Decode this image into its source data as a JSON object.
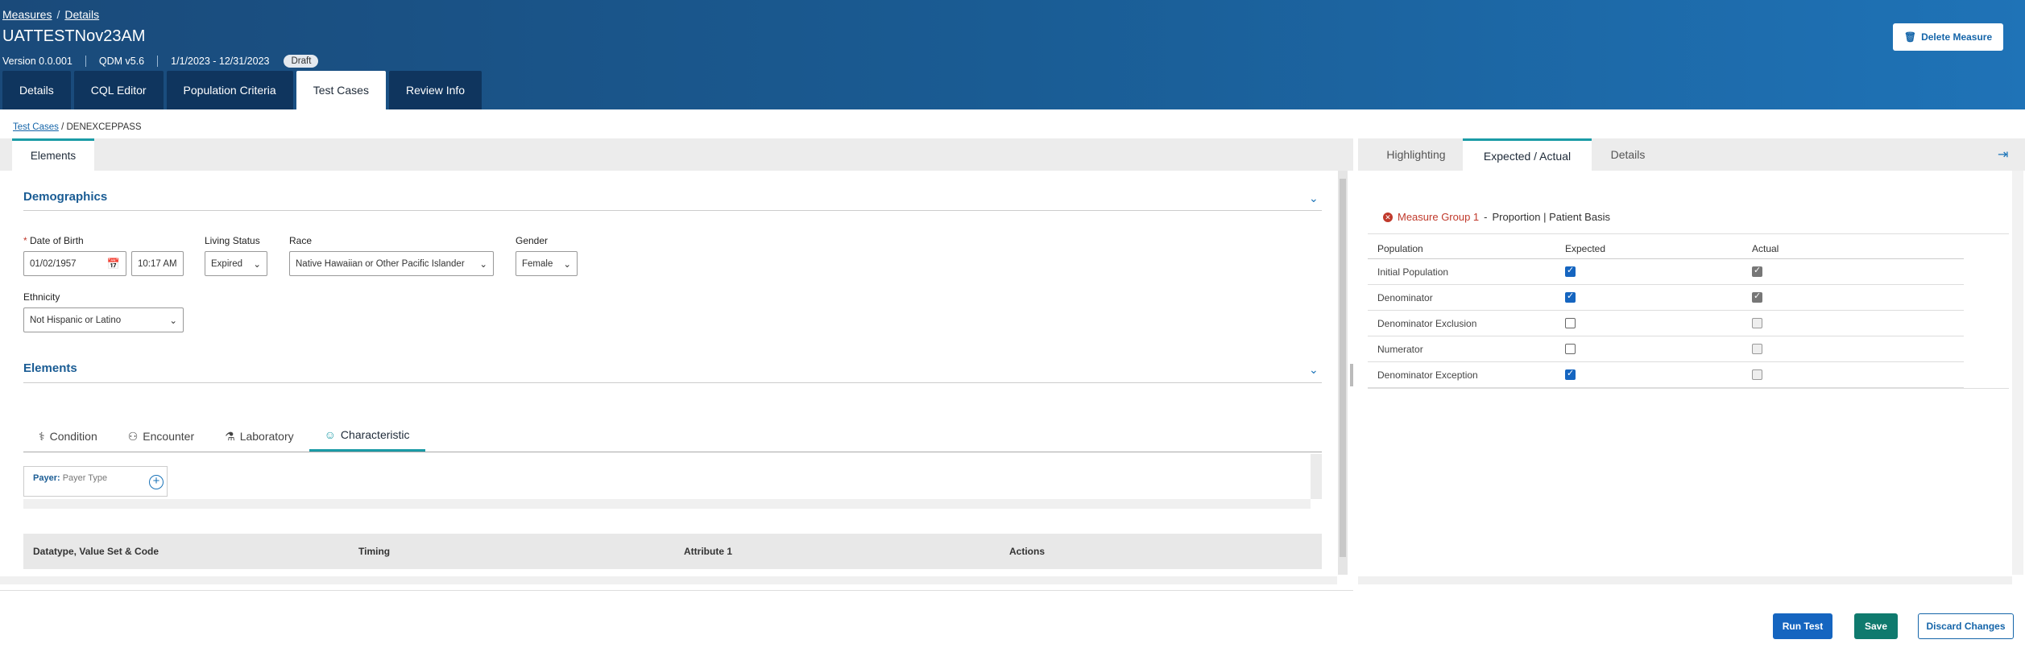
{
  "breadcrumb": {
    "measures": "Measures",
    "separator": "/",
    "details": "Details"
  },
  "measure": {
    "title": "UATTESTNov23AM",
    "version": "Version 0.0.001",
    "qdm": "QDM v5.6",
    "period": "1/1/2023 - 12/31/2023",
    "status": "Draft"
  },
  "delete_button": "Delete Measure",
  "main_tabs": [
    "Details",
    "CQL Editor",
    "Population Criteria",
    "Test Cases",
    "Review Info"
  ],
  "test_breadcrumb": {
    "link": "Test Cases",
    "current": "/ DENEXCEPPASS"
  },
  "left_tab": "Elements",
  "demographics": {
    "heading": "Demographics",
    "dob_label": "Date of Birth",
    "dob_value": "01/02/1957",
    "time_value": "10:17 AM",
    "living_label": "Living Status",
    "living_value": "Expired",
    "race_label": "Race",
    "race_value": "Native Hawaiian or Other Pacific Islander",
    "gender_label": "Gender",
    "gender_value": "Female",
    "ethnicity_label": "Ethnicity",
    "ethnicity_value": "Not Hispanic or Latino"
  },
  "elements": {
    "heading": "Elements",
    "tabs": [
      "Condition",
      "Encounter",
      "Laboratory",
      "Characteristic"
    ],
    "payer_label": "Payer:",
    "payer_type": "Payer Type",
    "columns": [
      "Datatype, Value Set & Code",
      "Timing",
      "Attribute 1",
      "Actions"
    ]
  },
  "right_tabs": [
    "Highlighting",
    "Expected / Actual",
    "Details"
  ],
  "measure_group": {
    "title": "Measure Group 1",
    "dash": " - ",
    "subtitle": "Proportion | Patient Basis"
  },
  "population_table": {
    "headers": [
      "Population",
      "Expected",
      "Actual"
    ],
    "rows": [
      {
        "name": "Initial Population",
        "expected": true,
        "actual": true
      },
      {
        "name": "Denominator",
        "expected": true,
        "actual": true
      },
      {
        "name": "Denominator Exclusion",
        "expected": false,
        "actual": false
      },
      {
        "name": "Numerator",
        "expected": false,
        "actual": false
      },
      {
        "name": "Denominator Exception",
        "expected": true,
        "actual": false
      }
    ]
  },
  "footer": {
    "run": "Run Test",
    "save": "Save",
    "discard": "Discard Changes"
  },
  "colors": {
    "header_dark": "#1a4a7a",
    "tab_dark": "#0f355e",
    "accent_teal": "#1a9ba6",
    "primary_blue": "#1565c0",
    "save_green": "#0f7a6e",
    "error_red": "#c0392b"
  }
}
